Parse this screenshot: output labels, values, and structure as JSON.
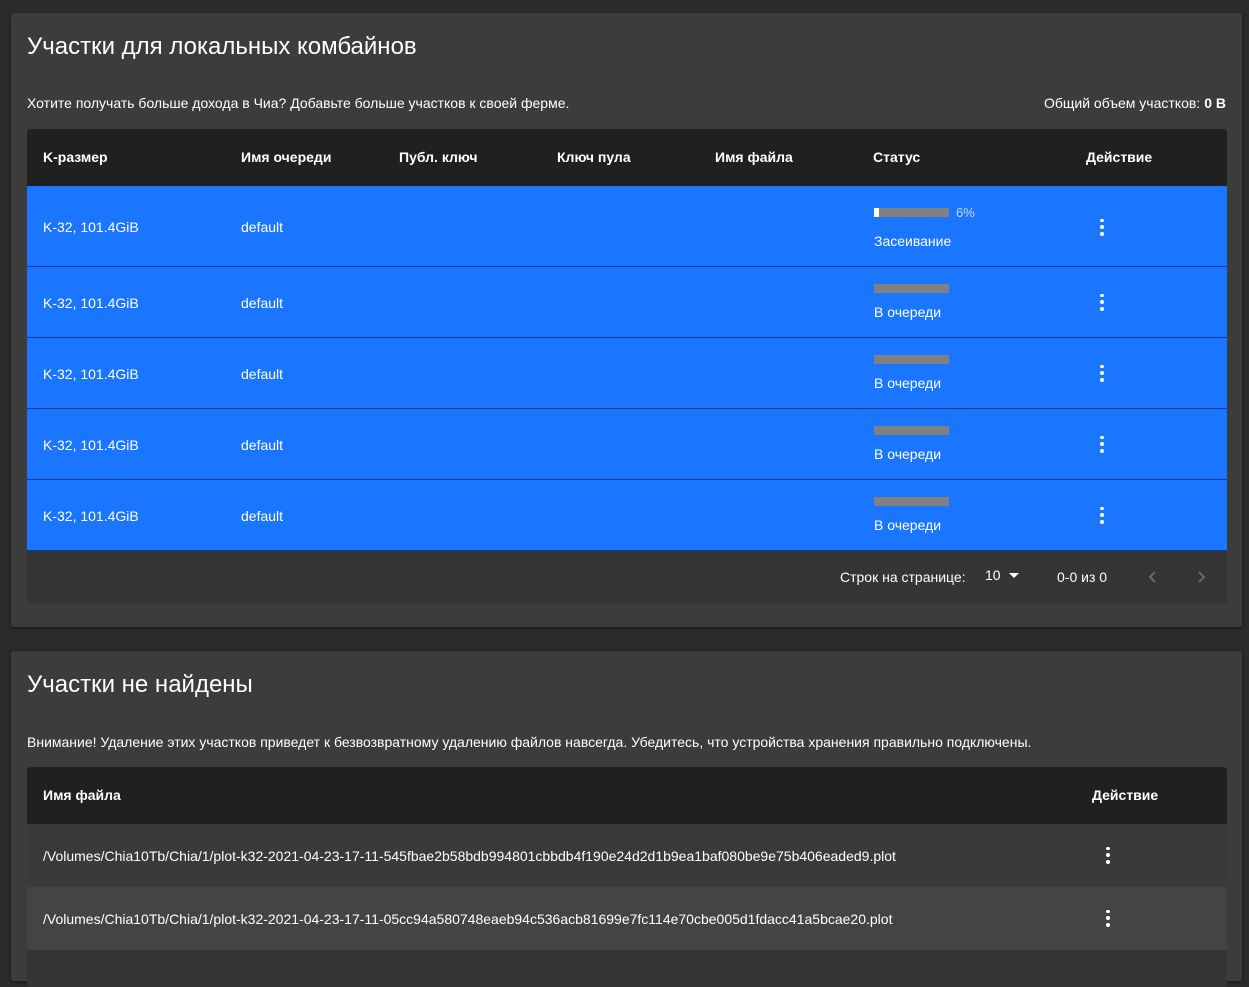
{
  "local_plots": {
    "title": "Участки для локальных комбайнов",
    "description": "Хотите получать больше дохода в Чиа? Добавьте больше участков к своей ферме.",
    "total_label": "Общий объем участков:",
    "total_value": "0 B",
    "columns": [
      "K-размер",
      "Имя очереди",
      "Публ. ключ",
      "Ключ пула",
      "Имя файла",
      "Статус",
      "Действие"
    ],
    "rows": [
      {
        "k_size": "K-32, 101.4GiB",
        "queue": "default",
        "progress": 6,
        "progress_label": "6%",
        "status": "Засеивание"
      },
      {
        "k_size": "K-32, 101.4GiB",
        "queue": "default",
        "progress": 0,
        "status": "В очереди"
      },
      {
        "k_size": "K-32, 101.4GiB",
        "queue": "default",
        "progress": 0,
        "status": "В очереди"
      },
      {
        "k_size": "K-32, 101.4GiB",
        "queue": "default",
        "progress": 0,
        "status": "В очереди"
      },
      {
        "k_size": "K-32, 101.4GiB",
        "queue": "default",
        "progress": 0,
        "status": "В очереди"
      }
    ],
    "pagination": {
      "rows_per_page_label": "Строк на странице:",
      "rows_per_page_value": "10",
      "range": "0-0 из 0"
    }
  },
  "missing_plots": {
    "title": "Участки не найдены",
    "description": "Внимание! Удаление этих участков приведет к безвозвратному удалению файлов навсегда. Убедитесь, что устройства хранения правильно подключены.",
    "columns": [
      "Имя файла",
      "Действие"
    ],
    "rows": [
      {
        "filename": "/Volumes/Chia10Tb/Chia/1/plot-k32-2021-04-23-17-11-545fbae2b58bdb994801cbbdb4f190e24d2d1b9ea1baf080be9e75b406eaded9.plot"
      },
      {
        "filename": "/Volumes/Chia10Tb/Chia/1/plot-k32-2021-04-23-17-11-05cc94a580748eaeb94c536acb81699e7fc114e70cbe005d1fdacc41a5bcae20.plot"
      }
    ]
  },
  "colors": {
    "row_highlight": "#1a75ff",
    "card_bg": "#3c3c3c",
    "header_bg": "#202020",
    "progress_track": "#808080"
  }
}
